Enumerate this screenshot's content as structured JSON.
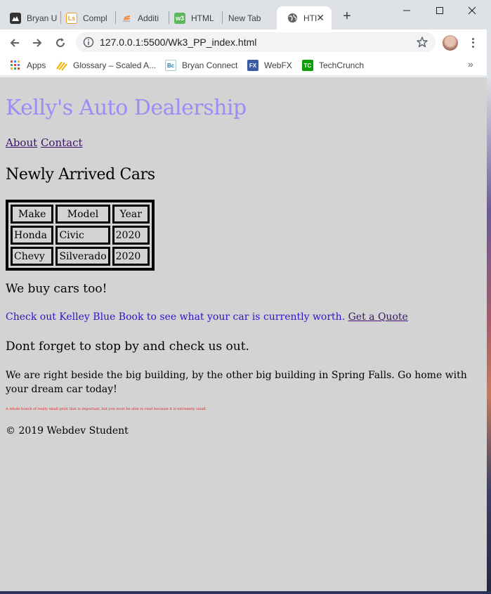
{
  "browser": {
    "tabs": [
      {
        "title": "Bryan U",
        "icon": "github-icon",
        "color": "#333333"
      },
      {
        "title": "Compl",
        "icon": "lesson-icon",
        "color": "#f29b21"
      },
      {
        "title": "Additi",
        "icon": "stack-icon",
        "color": "#f48024"
      },
      {
        "title": "HTML",
        "icon": "w3schools-icon",
        "color": "#5cb85c"
      },
      {
        "title": "New Tab",
        "icon": "",
        "color": ""
      },
      {
        "title": "HTI",
        "icon": "globe-icon",
        "color": "#5f6368",
        "active": true
      }
    ],
    "url": "127.0.0.1:5500/Wk3_PP_index.html",
    "bookmarks": [
      {
        "label": "Apps",
        "icon": "apps-icon"
      },
      {
        "label": "Glossary – Scaled A...",
        "icon": "safe-icon",
        "color": "#f0b400"
      },
      {
        "label": "Bryan Connect",
        "icon": "bc-icon",
        "color": "#2a7ab0"
      },
      {
        "label": "WebFX",
        "icon": "webfx-icon",
        "color": "#3b5ba5"
      },
      {
        "label": "TechCrunch",
        "icon": "techcrunch-icon",
        "color": "#0a9e01"
      }
    ],
    "bookmarks_more": "»"
  },
  "page": {
    "site_title": "Kelly's Auto Dealership",
    "nav": {
      "about": "About",
      "contact": "Contact"
    },
    "new_cars_heading": "Newly Arrived Cars",
    "table": {
      "headers": [
        "Make",
        "Model",
        "Year"
      ],
      "rows": [
        [
          "Honda",
          "Civic",
          "2020"
        ],
        [
          "Chevy",
          "Silverado",
          "2020"
        ]
      ]
    },
    "buy_heading": "We buy cars too!",
    "kbb_text": "Check out Kelley Blue Book to see what your car is currently worth.",
    "quote_link": "Get a Quote",
    "stop_heading": "Dont forget to stop by and check us out.",
    "directions": "We are right beside the big building, by the other big building in Spring Falls. Go home with your dream car today!",
    "fine_print": "A whole bunch of really small print that is important, but you wont be able to read because it is extremely small.",
    "copyright": "© 2019 Webdev Student"
  },
  "colors": {
    "title": "#9a8df5",
    "link": "#3a1466",
    "kbb": "#2e14c8",
    "fine_print": "#e21b1b",
    "page_bg": "#d3d3d3"
  }
}
